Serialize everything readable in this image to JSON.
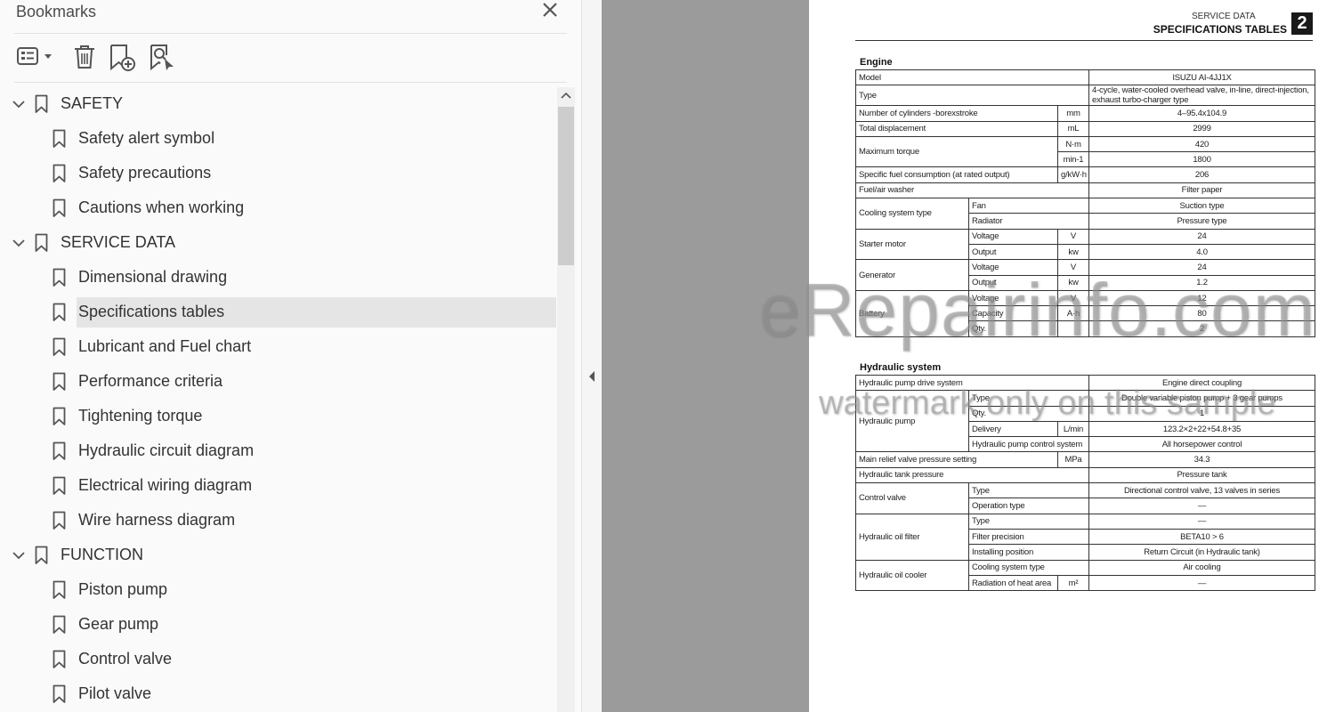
{
  "panel": {
    "title": "Bookmarks",
    "toolbar": [
      {
        "name": "options-menu-button",
        "icon": "list-options-icon"
      },
      {
        "name": "delete-bookmark-button",
        "icon": "trash-icon"
      },
      {
        "name": "add-bookmark-button",
        "icon": "add-bookmark-icon"
      },
      {
        "name": "find-current-bookmark-button",
        "icon": "find-bookmark-icon"
      }
    ],
    "bookmarks": [
      {
        "label": "SAFETY",
        "level": 0,
        "expanded": true
      },
      {
        "label": "Safety alert symbol",
        "level": 1
      },
      {
        "label": "Safety precautions",
        "level": 1
      },
      {
        "label": "Cautions when working",
        "level": 1
      },
      {
        "label": "SERVICE DATA",
        "level": 0,
        "expanded": true
      },
      {
        "label": "Dimensional drawing",
        "level": 1
      },
      {
        "label": "Specifications tables",
        "level": 1,
        "selected": true
      },
      {
        "label": "Lubricant and Fuel chart",
        "level": 1
      },
      {
        "label": "Performance criteria",
        "level": 1
      },
      {
        "label": "Tightening torque",
        "level": 1
      },
      {
        "label": "Hydraulic circuit diagram",
        "level": 1
      },
      {
        "label": "Electrical wiring diagram",
        "level": 1
      },
      {
        "label": "Wire harness diagram",
        "level": 1
      },
      {
        "label": "FUNCTION",
        "level": 0,
        "expanded": true
      },
      {
        "label": "Piston pump",
        "level": 1
      },
      {
        "label": "Gear pump",
        "level": 1
      },
      {
        "label": "Control valve",
        "level": 1
      },
      {
        "label": "Pilot valve",
        "level": 1
      }
    ]
  },
  "page": {
    "header_small": "SERVICE DATA",
    "header_title": "SPECIFICATIONS TABLES",
    "chapter": "2",
    "engine_title": "Engine",
    "engine_rows": [
      [
        {
          "t": "Model",
          "cs": 3
        },
        {
          "t": "ISUZU AI-4JJ1X",
          "c": true
        }
      ],
      [
        {
          "t": "Type",
          "cs": 3
        },
        {
          "t": "4-cycle, water-cooled overhead valve, in-line, direct-injection, exhaust turbo-charger type",
          "wrap": true
        }
      ],
      [
        {
          "t": "Number of cylinders -borexstroke",
          "cs": 2
        },
        {
          "t": "mm",
          "c": true
        },
        {
          "t": "4–95.4x104.9",
          "c": true
        }
      ],
      [
        {
          "t": "Total displacement",
          "cs": 2
        },
        {
          "t": "mL",
          "c": true
        },
        {
          "t": "2999",
          "c": true
        }
      ],
      [
        {
          "t": "Maximum torque",
          "cs": 2,
          "rs": 2
        },
        {
          "t": "N·m",
          "c": true
        },
        {
          "t": "420",
          "c": true
        }
      ],
      [
        {
          "t": "min-1",
          "c": true
        },
        {
          "t": "1800",
          "c": true
        }
      ],
      [
        {
          "t": "Specific fuel consumption (at rated output)",
          "cs": 2
        },
        {
          "t": "g/kW·h",
          "c": true
        },
        {
          "t": "206",
          "c": true
        }
      ],
      [
        {
          "t": "Fuel/air washer",
          "cs": 3
        },
        {
          "t": "Filter paper",
          "c": true
        }
      ],
      [
        {
          "t": "Cooling system type",
          "rs": 2
        },
        {
          "t": "Fan",
          "cs": 2
        },
        {
          "t": "Suction type",
          "c": true
        }
      ],
      [
        {
          "t": "Radiator",
          "cs": 2
        },
        {
          "t": "Pressure type",
          "c": true
        }
      ],
      [
        {
          "t": "Starter motor",
          "rs": 2
        },
        {
          "t": "Voltage"
        },
        {
          "t": "V",
          "c": true
        },
        {
          "t": "24",
          "c": true
        }
      ],
      [
        {
          "t": "Output"
        },
        {
          "t": "kw",
          "c": true
        },
        {
          "t": "4.0",
          "c": true
        }
      ],
      [
        {
          "t": "Generator",
          "rs": 2
        },
        {
          "t": "Voltage"
        },
        {
          "t": "V",
          "c": true
        },
        {
          "t": "24",
          "c": true
        }
      ],
      [
        {
          "t": "Output"
        },
        {
          "t": "kw",
          "c": true
        },
        {
          "t": "1.2",
          "c": true
        }
      ],
      [
        {
          "t": "Battery",
          "rs": 3
        },
        {
          "t": "Voltage"
        },
        {
          "t": "V",
          "c": true
        },
        {
          "t": "12",
          "c": true
        }
      ],
      [
        {
          "t": "Capacity"
        },
        {
          "t": "A·h",
          "c": true
        },
        {
          "t": "80",
          "c": true
        }
      ],
      [
        {
          "t": "Qty."
        },
        {
          "t": ""
        },
        {
          "t": "2",
          "c": true
        }
      ]
    ],
    "hydraulic_title": "Hydraulic system",
    "hydraulic_rows": [
      [
        {
          "t": "Hydraulic pump drive system",
          "cs": 3
        },
        {
          "t": "Engine direct coupling",
          "c": true
        }
      ],
      [
        {
          "t": "Hydraulic pump",
          "rs": 4
        },
        {
          "t": "Type",
          "cs": 2
        },
        {
          "t": "Double variable piston pump + 3 gear pumps",
          "c": true
        }
      ],
      [
        {
          "t": "Qty.",
          "cs": 2
        },
        {
          "t": "1",
          "c": true
        }
      ],
      [
        {
          "t": "Delivery"
        },
        {
          "t": "L/min",
          "c": true
        },
        {
          "t": "123.2×2+22+54.8+35",
          "c": true
        }
      ],
      [
        {
          "t": "Hydraulic pump control system",
          "cs": 2
        },
        {
          "t": "All horsepower control",
          "c": true
        }
      ],
      [
        {
          "t": "Main relief valve pressure setting",
          "cs": 2
        },
        {
          "t": "MPa",
          "c": true
        },
        {
          "t": "34.3",
          "c": true
        }
      ],
      [
        {
          "t": "Hydraulic tank pressure",
          "cs": 3
        },
        {
          "t": "Pressure tank",
          "c": true
        }
      ],
      [
        {
          "t": "Control valve",
          "rs": 2
        },
        {
          "t": "Type",
          "cs": 2
        },
        {
          "t": "Directional control valve, 13 valves in series",
          "c": true
        }
      ],
      [
        {
          "t": "Operation type",
          "cs": 2
        },
        {
          "t": "—",
          "c": true
        }
      ],
      [
        {
          "t": "Hydraulic oil filter",
          "rs": 3
        },
        {
          "t": "Type",
          "cs": 2
        },
        {
          "t": "—",
          "c": true
        }
      ],
      [
        {
          "t": "Filter precision",
          "cs": 2
        },
        {
          "t": "BETA10 > 6",
          "c": true
        }
      ],
      [
        {
          "t": "Installing position",
          "cs": 2
        },
        {
          "t": "Return Circuit (in Hydraulic tank)",
          "c": true
        }
      ],
      [
        {
          "t": "Hydraulic oil cooler",
          "rs": 2
        },
        {
          "t": "Cooling system type",
          "cs": 2
        },
        {
          "t": "Air cooling",
          "c": true
        }
      ],
      [
        {
          "t": "Radiation of heat area"
        },
        {
          "t": "m²",
          "c": true
        },
        {
          "t": "—",
          "c": true
        }
      ]
    ]
  },
  "watermark": {
    "line1": "eRepairinfo.com",
    "line2": "watermark only on this sample"
  }
}
